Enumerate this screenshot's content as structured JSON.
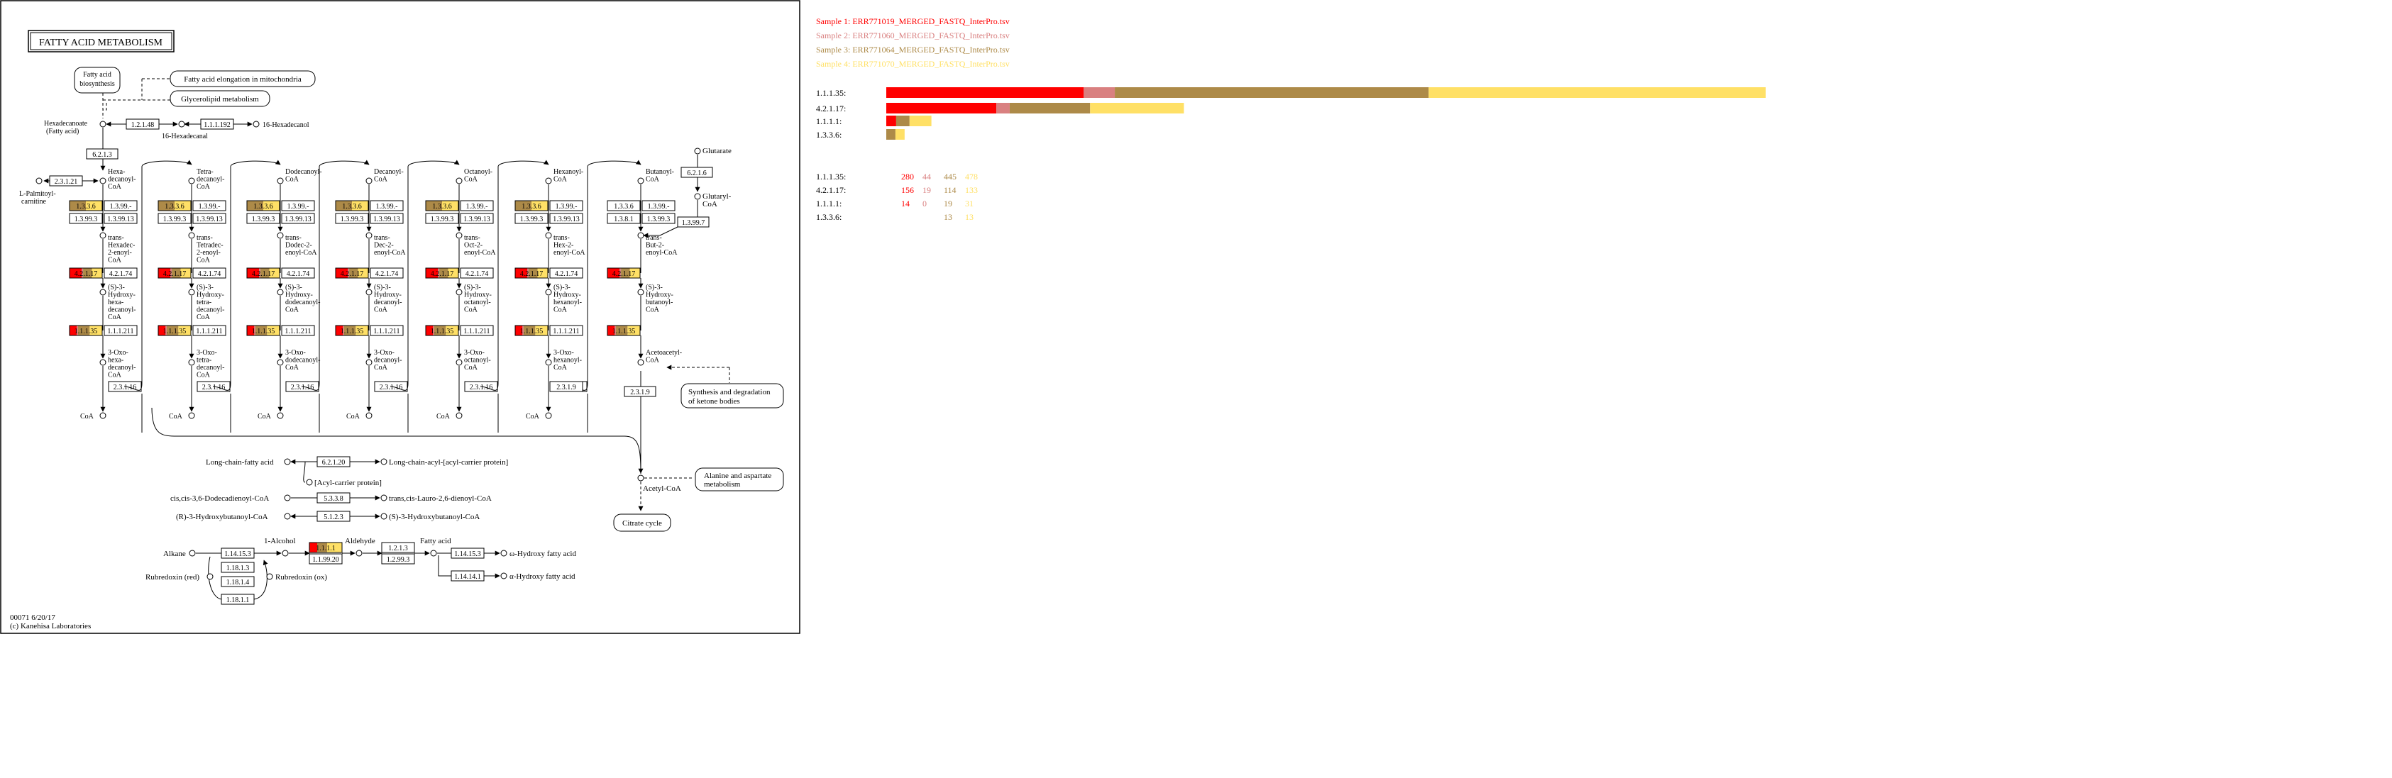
{
  "map": {
    "title": "FATTY ACID METABOLISM",
    "footer_id": "00071 6/20/17",
    "footer_copy": "(c) Kanehisa Laboratories"
  },
  "colors": {
    "s1": "#ff0000",
    "s2": "#d98080",
    "s3": "#ad8a48",
    "s4": "#ffe066",
    "line": "#000000"
  },
  "legend": [
    {
      "label": "Sample 1: ERR771019_MERGED_FASTQ_InterPro.tsv",
      "color": "#ff0000"
    },
    {
      "label": "Sample 2: ERR771060_MERGED_FASTQ_InterPro.tsv",
      "color": "#d98080"
    },
    {
      "label": "Sample 3: ERR771064_MERGED_FASTQ_InterPro.tsv",
      "color": "#ad8a48"
    },
    {
      "label": "Sample 4: ERR771070_MERGED_FASTQ_InterPro.tsv",
      "color": "#ffe066"
    }
  ],
  "chart_data": {
    "type": "bar",
    "orientation": "horizontal",
    "stacked": true,
    "categories": [
      "1.1.1.35:",
      "4.2.1.17:",
      "1.1.1.1:",
      "1.3.3.6:"
    ],
    "series": [
      {
        "name": "Sample 1: ERR771019_MERGED_FASTQ_InterPro.tsv",
        "values": [
          280,
          156,
          14,
          0
        ]
      },
      {
        "name": "Sample 2: ERR771060_MERGED_FASTQ_InterPro.tsv",
        "values": [
          44,
          19,
          0,
          0
        ]
      },
      {
        "name": "Sample 3: ERR771064_MERGED_FASTQ_InterPro.tsv",
        "values": [
          445,
          114,
          19,
          13
        ]
      },
      {
        "name": "Sample 4: ERR771070_MERGED_FASTQ_InterPro.tsv",
        "values": [
          478,
          133,
          31,
          13
        ]
      }
    ],
    "count_labels": [
      [
        "280",
        "44",
        "445",
        "478"
      ],
      [
        "156",
        "19",
        "114",
        "133"
      ],
      [
        "14",
        "0",
        "19",
        "31"
      ],
      [
        "",
        "",
        "13",
        "13"
      ]
    ]
  },
  "compounds": {
    "hexadecanoate": "Hexadecanoate",
    "fatty_acid_paren": "(Fatty acid)",
    "hexadecanal": "16-Hexadecanal",
    "hexadecanol": "16-Hexadecanol",
    "palmitoyl_carnitine_1": "L-Palmitoyl-",
    "palmitoyl_carnitine_2": "carnitine",
    "hexadecanoyl_coa": "Hexa-decanoyl-CoA",
    "trans_hexadec": "trans-Hexadec-2-enoyl-CoA",
    "hydroxy_hexadec": "(S)-3-Hydroxy-hexa-decanoyl-CoA",
    "oxo_hexadec": "3-Oxo-hexa-decanoyl-CoA",
    "tetradecanoyl": "Tetra-decanoyl-CoA",
    "trans_tetradec": "trans-Tetradec-2-enoyl-CoA",
    "hydroxy_tetradec": "(S)-3-Hydroxy-tetra-decanoyl-CoA",
    "oxo_tetradec": "3-Oxo-tetra-decanoyl-CoA",
    "dodecanoyl": "Dodecanoyl-CoA",
    "trans_dodec": "trans-Dodec-2-enoyl-CoA",
    "hydroxy_dodec": "(S)-3-Hydroxy-dodecanoyl-CoA",
    "oxo_dodec": "3-Oxo-dodecanoyl-CoA",
    "decanoyl": "Decanoyl-CoA",
    "trans_dec": "trans-Dec-2-enoyl-CoA",
    "hydroxy_dec": "(S)-3-Hydroxy-decanoyl-CoA",
    "oxo_dec": "3-Oxo-decanoyl-CoA",
    "octanoyl": "Octanoyl-CoA",
    "trans_oct": "trans-Oct-2-enoyl-CoA",
    "hydroxy_oct": "(S)-3-Hydroxy-octanoyl-CoA",
    "oxo_oct": "3-Oxo-octanoyl-CoA",
    "hexanoyl": "Hexanoyl-CoA",
    "trans_hex": "trans-Hex-2-enoyl-CoA",
    "hydroxy_hex": "(S)-3-Hydroxy-hexanoyl-CoA",
    "oxo_hex": "3-Oxo-hexanoyl-CoA",
    "butanoyl": "Butanoyl-CoA",
    "trans_but": "trans-But-2-enoyl-CoA",
    "hydroxy_but": "(S)-3-Hydroxy-butanoyl-CoA",
    "acetoacetyl": "Acetoacetyl-CoA",
    "acetyl": "Acetyl-CoA",
    "glutarate": "Glutarate",
    "glutaryl": "Glutaryl-CoA",
    "coa": "CoA",
    "long_chain_fa": "Long-chain-fatty acid",
    "long_chain_acyl_acp": "Long-chain-acyl-[acyl-carrier protein]",
    "acp": "[Acyl-carrier protein]",
    "cis_dodecadienoyl": "cis,cis-3,6-Dodecadienoyl-CoA",
    "trans_lauro": "trans,cis-Lauro-2,6-dienoyl-CoA",
    "r3_hydroxybutanoyl": "(R)-3-Hydroxybutanoyl-CoA",
    "s3_hydroxybutanoyl": "(S)-3-Hydroxybutanoyl-CoA",
    "alkane": "Alkane",
    "alcohol": "1-Alcohol",
    "aldehyde": "Aldehyde",
    "fatty_acid": "Fatty acid",
    "omega_hydroxy": "ω-Hydroxy fatty acid",
    "alpha_hydroxy": "α-Hydroxy fatty acid",
    "rubredoxin_red": "Rubredoxin (red)",
    "rubredoxin_ox": "Rubredoxin (ox)"
  },
  "pathways": {
    "fa_biosynthesis": "Fatty acid biosynthesis",
    "fa_elongation": "Fatty acid elongation in mitochondria",
    "glycerolipid": "Glycerolipid metabolism",
    "ketone_bodies": "Synthesis and degradation of ketone bodies",
    "alanine": "Alanine and aspartate metabolism",
    "citrate": "Citrate cycle"
  },
  "enzymes": {
    "e_1_2_1_48": "1.2.1.48",
    "e_1_1_1_192": "1.1.1.192",
    "e_6_2_1_3": "6.2.1.3",
    "e_2_3_1_21": "2.3.1.21",
    "e_1_3_3_6": "1.3.3.6",
    "e_1_3_99_short": "1.3.99.-",
    "e_1_3_99_3": "1.3.99.3",
    "e_1_3_99_13": "1.3.99.13",
    "e_4_2_1_17": "4.2.1.17",
    "e_4_2_1_74": "4.2.1.74",
    "e_1_1_1_35": "1.1.1.35",
    "e_1_1_1_211": "1.1.1.211",
    "e_2_3_1_16": "2.3.1.16",
    "e_1_3_8_1": "1.3.8.1",
    "e_6_2_1_6": "6.2.1.6",
    "e_1_3_99_7": "1.3.99.7",
    "e_2_3_1_9": "2.3.1.9",
    "e_6_2_1_20": "6.2.1.20",
    "e_5_3_3_8": "5.3.3.8",
    "e_5_1_2_3": "5.1.2.3",
    "e_1_14_15_3": "1.14.15.3",
    "e_1_18_1_3": "1.18.1.3",
    "e_1_18_1_4": "1.18.1.4",
    "e_1_18_1_1": "1.18.1.1",
    "e_1_1_1_1": "1.1.1.1",
    "e_1_1_99_20": "1.1.99.20",
    "e_1_2_1_3": "1.2.1.3",
    "e_1_2_99_3": "1.2.99.3",
    "e_1_14_14_1": "1.14.14.1"
  }
}
